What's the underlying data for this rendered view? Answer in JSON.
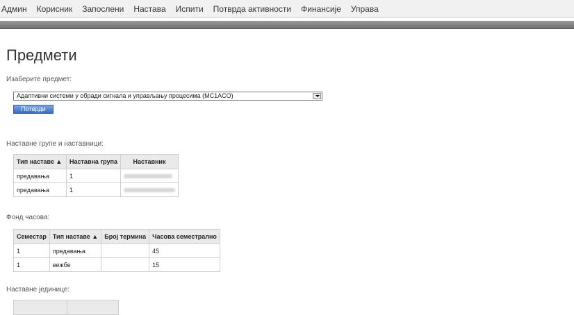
{
  "nav": [
    "Админ",
    "Корисник",
    "Запослени",
    "Настава",
    "Испити",
    "Потврда активности",
    "Финансије",
    "Управа"
  ],
  "page_title": "Предмети",
  "select_label": "Изаберите предмет:",
  "selected_subject": "Адаптивни системи у обради сигнала и управљању процесима (MC1ACO)",
  "confirm_button": "Потврди",
  "groups": {
    "label": "Наставне групе и наставници:",
    "headers": [
      "Тип наставе ▲",
      "Наставна група",
      "Наставник"
    ],
    "rows": [
      {
        "type": "предавања",
        "group": "1"
      },
      {
        "type": "предавања",
        "group": "1"
      }
    ]
  },
  "hours": {
    "label": "Фонд часова:",
    "headers": [
      "Семестар",
      "Тип наставе ▲",
      "Број термина",
      "Часова семестрално"
    ],
    "rows": [
      {
        "semester": "1",
        "type": "предавања",
        "count": "",
        "hours": "45"
      },
      {
        "semester": "1",
        "type": "вежбе",
        "count": "",
        "hours": "15"
      }
    ]
  },
  "units_label": "Наставне јединице:"
}
